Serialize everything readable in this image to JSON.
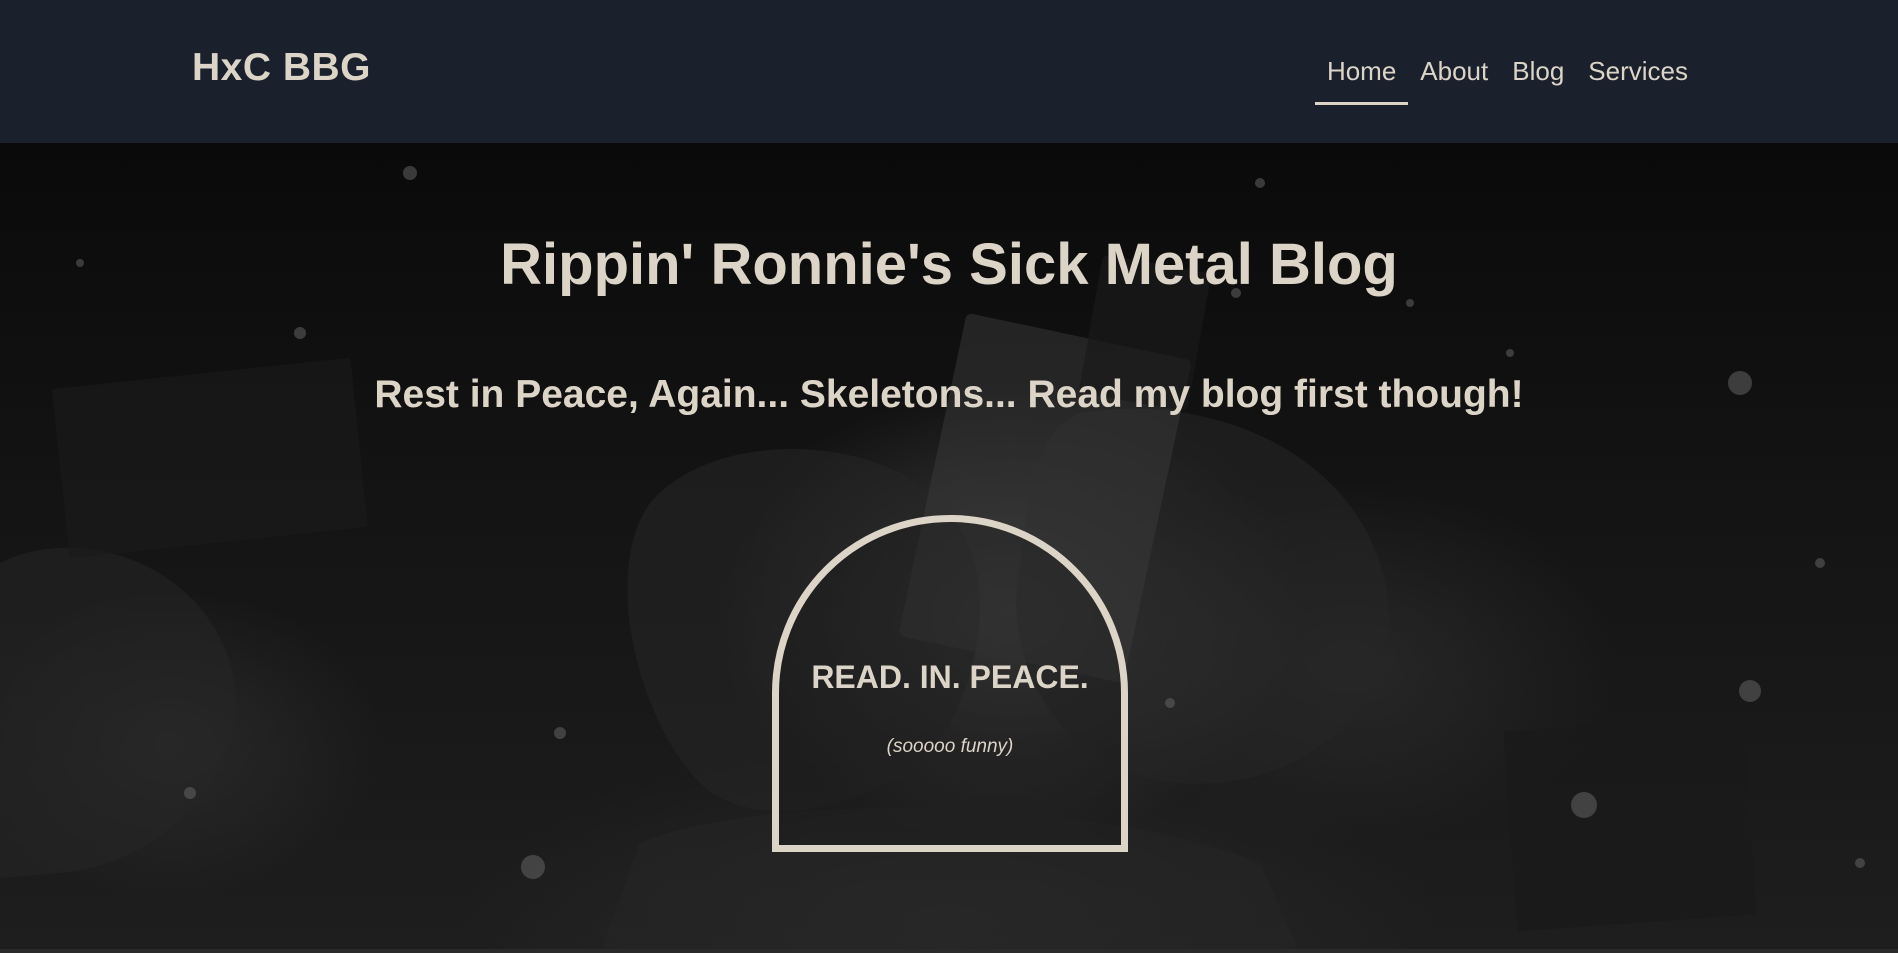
{
  "navbar": {
    "brand": "HxC BBG",
    "links": [
      {
        "label": "Home",
        "active": true
      },
      {
        "label": "About",
        "active": false
      },
      {
        "label": "Blog",
        "active": false
      },
      {
        "label": "Services",
        "active": false
      }
    ]
  },
  "hero": {
    "title": "Rippin' Ronnie's Sick Metal Blog",
    "subtitle": "Rest in Peace, Again... Skeletons... Read my blog first though!",
    "tombstone": {
      "main": "READ. IN. PEACE.",
      "note": "(sooooo funny)"
    }
  },
  "colors": {
    "navbar_bg": "#1a212d",
    "text": "#ddd4c8",
    "hero_bg": "#0b0b0b"
  }
}
